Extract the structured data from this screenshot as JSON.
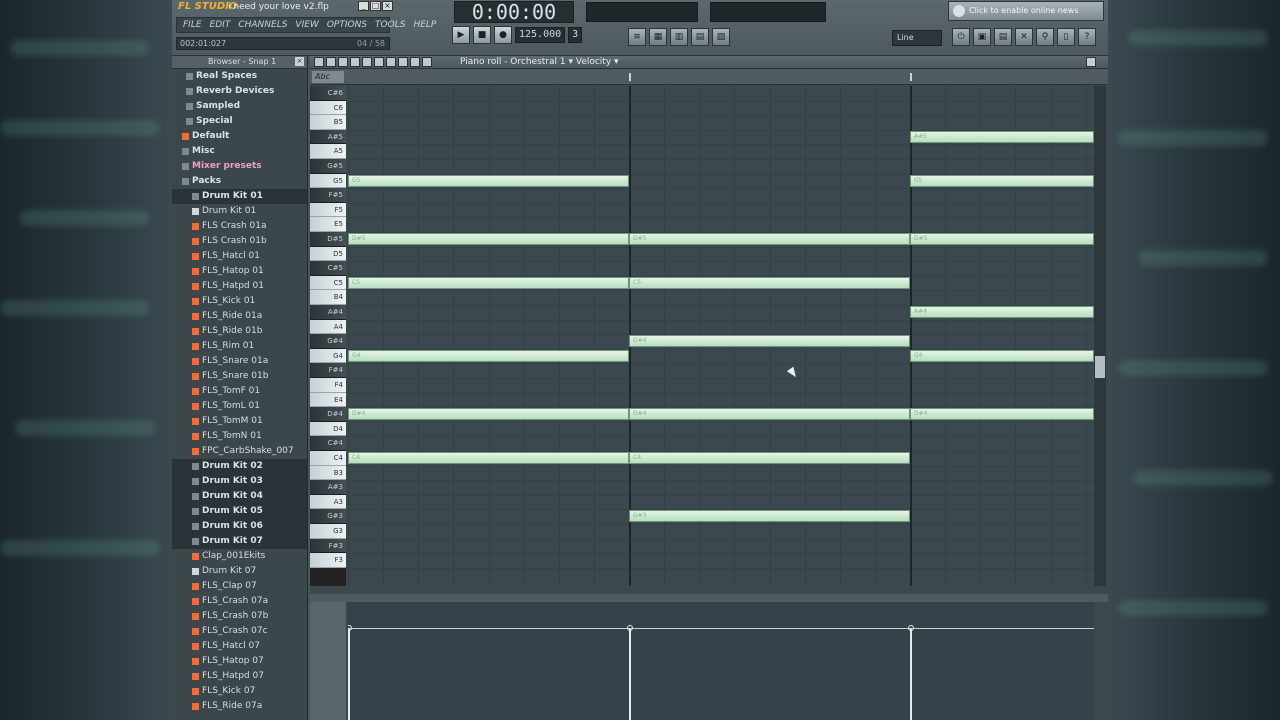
{
  "app": {
    "logo": "FL STUDIO",
    "file_title": "i need your love v2.flp",
    "menu": [
      "FILE",
      "EDIT",
      "CHANNELS",
      "VIEW",
      "OPTIONS",
      "TOOLS",
      "HELP"
    ],
    "hint_left": "002:01:027",
    "hint_right": "04 / 58",
    "time": "0:00:00",
    "tempo": "125.000",
    "pattern": "3",
    "snap": "Line",
    "news": "Click to enable online news"
  },
  "browser": {
    "header": "Browser - Snap 1",
    "items": [
      {
        "label": "Real Spaces",
        "kind": "folder",
        "icon": "gray"
      },
      {
        "label": "Reverb Devices",
        "kind": "folder",
        "icon": "gray"
      },
      {
        "label": "Sampled",
        "kind": "folder",
        "icon": "gray"
      },
      {
        "label": "Special",
        "kind": "folder",
        "icon": "gray"
      },
      {
        "label": "Default",
        "kind": "folder",
        "icon": "orange"
      },
      {
        "label": "Misc",
        "kind": "folder",
        "icon": "gray"
      },
      {
        "label": "Mixer presets",
        "kind": "folder-highlight",
        "icon": "gray"
      },
      {
        "label": "Packs",
        "kind": "folder",
        "icon": "gray"
      },
      {
        "label": "Drum Kit 01",
        "kind": "folder-selected",
        "icon": "gray"
      },
      {
        "label": "Drum Kit 01",
        "kind": "file",
        "icon": "white"
      },
      {
        "label": "FLS Crash 01a",
        "kind": "file",
        "icon": "orange"
      },
      {
        "label": "FLS Crash 01b",
        "kind": "file",
        "icon": "orange"
      },
      {
        "label": "FLS_Hatcl 01",
        "kind": "file",
        "icon": "orange"
      },
      {
        "label": "FLS_Hatop 01",
        "kind": "file",
        "icon": "orange"
      },
      {
        "label": "FLS_Hatpd 01",
        "kind": "file",
        "icon": "orange"
      },
      {
        "label": "FLS_Kick 01",
        "kind": "file",
        "icon": "orange"
      },
      {
        "label": "FLS_Ride 01a",
        "kind": "file",
        "icon": "orange"
      },
      {
        "label": "FLS_Ride 01b",
        "kind": "file",
        "icon": "orange"
      },
      {
        "label": "FLS_Rim 01",
        "kind": "file",
        "icon": "orange"
      },
      {
        "label": "FLS_Snare 01a",
        "kind": "file",
        "icon": "orange"
      },
      {
        "label": "FLS_Snare 01b",
        "kind": "file",
        "icon": "orange"
      },
      {
        "label": "FLS_TomF 01",
        "kind": "file",
        "icon": "orange"
      },
      {
        "label": "FLS_TomL 01",
        "kind": "file",
        "icon": "orange"
      },
      {
        "label": "FLS_TomM 01",
        "kind": "file",
        "icon": "orange"
      },
      {
        "label": "FLS_TomN 01",
        "kind": "file",
        "icon": "orange"
      },
      {
        "label": "FPC_CarbShake_007",
        "kind": "file",
        "icon": "orange"
      },
      {
        "label": "Drum Kit 02",
        "kind": "folder-selected",
        "icon": "gray"
      },
      {
        "label": "Drum Kit 03",
        "kind": "folder-selected",
        "icon": "gray"
      },
      {
        "label": "Drum Kit 04",
        "kind": "folder-selected",
        "icon": "gray"
      },
      {
        "label": "Drum Kit 05",
        "kind": "folder-selected",
        "icon": "gray"
      },
      {
        "label": "Drum Kit 06",
        "kind": "folder-selected",
        "icon": "gray"
      },
      {
        "label": "Drum Kit 07",
        "kind": "folder-selected",
        "icon": "gray"
      },
      {
        "label": "Clap_001Ekits",
        "kind": "file",
        "icon": "orange"
      },
      {
        "label": "Drum Kit 07",
        "kind": "file",
        "icon": "white"
      },
      {
        "label": "FLS_Clap 07",
        "kind": "file",
        "icon": "orange"
      },
      {
        "label": "FLS_Crash 07a",
        "kind": "file",
        "icon": "orange"
      },
      {
        "label": "FLS_Crash 07b",
        "kind": "file",
        "icon": "orange"
      },
      {
        "label": "FLS_Crash 07c",
        "kind": "file",
        "icon": "orange"
      },
      {
        "label": "FLS_Hatcl 07",
        "kind": "file",
        "icon": "orange"
      },
      {
        "label": "FLS_Hatop 07",
        "kind": "file",
        "icon": "orange"
      },
      {
        "label": "FLS_Hatpd 07",
        "kind": "file",
        "icon": "orange"
      },
      {
        "label": "FLS_Kick 07",
        "kind": "file",
        "icon": "orange"
      },
      {
        "label": "FLS_Ride 07a",
        "kind": "file",
        "icon": "orange"
      }
    ]
  },
  "piano_roll": {
    "title": "Piano roll - Orchestral 1",
    "target": "Velocity",
    "abc_label": "Abc",
    "keys": [
      "C#6",
      "C6",
      "B5",
      "A#5",
      "A5",
      "G#5",
      "G5",
      "F#5",
      "F5",
      "E5",
      "D#5",
      "D5",
      "C#5",
      "C5",
      "B4",
      "A#4",
      "A4",
      "G#4",
      "G4",
      "F#4",
      "F4",
      "E4",
      "D#4",
      "D4",
      "C#4",
      "C4",
      "B3",
      "A#3",
      "A3",
      "G#3",
      "G3",
      "F#3",
      "F3"
    ],
    "bars": 3,
    "notes": [
      {
        "pitch": "G5",
        "bar": 1
      },
      {
        "pitch": "D#5",
        "bar": 1
      },
      {
        "pitch": "C5",
        "bar": 1
      },
      {
        "pitch": "G4",
        "bar": 1
      },
      {
        "pitch": "D#4",
        "bar": 1
      },
      {
        "pitch": "C4",
        "bar": 1
      },
      {
        "pitch": "D#5",
        "bar": 2
      },
      {
        "pitch": "C5",
        "bar": 2
      },
      {
        "pitch": "G#4",
        "bar": 2
      },
      {
        "pitch": "D#4",
        "bar": 2
      },
      {
        "pitch": "C4",
        "bar": 2
      },
      {
        "pitch": "G#3",
        "bar": 2
      },
      {
        "pitch": "A#5",
        "bar": 3
      },
      {
        "pitch": "G5",
        "bar": 3
      },
      {
        "pitch": "D#5",
        "bar": 3
      },
      {
        "pitch": "A#4",
        "bar": 3
      },
      {
        "pitch": "G4",
        "bar": 3
      },
      {
        "pitch": "D#4",
        "bar": 3
      }
    ]
  }
}
